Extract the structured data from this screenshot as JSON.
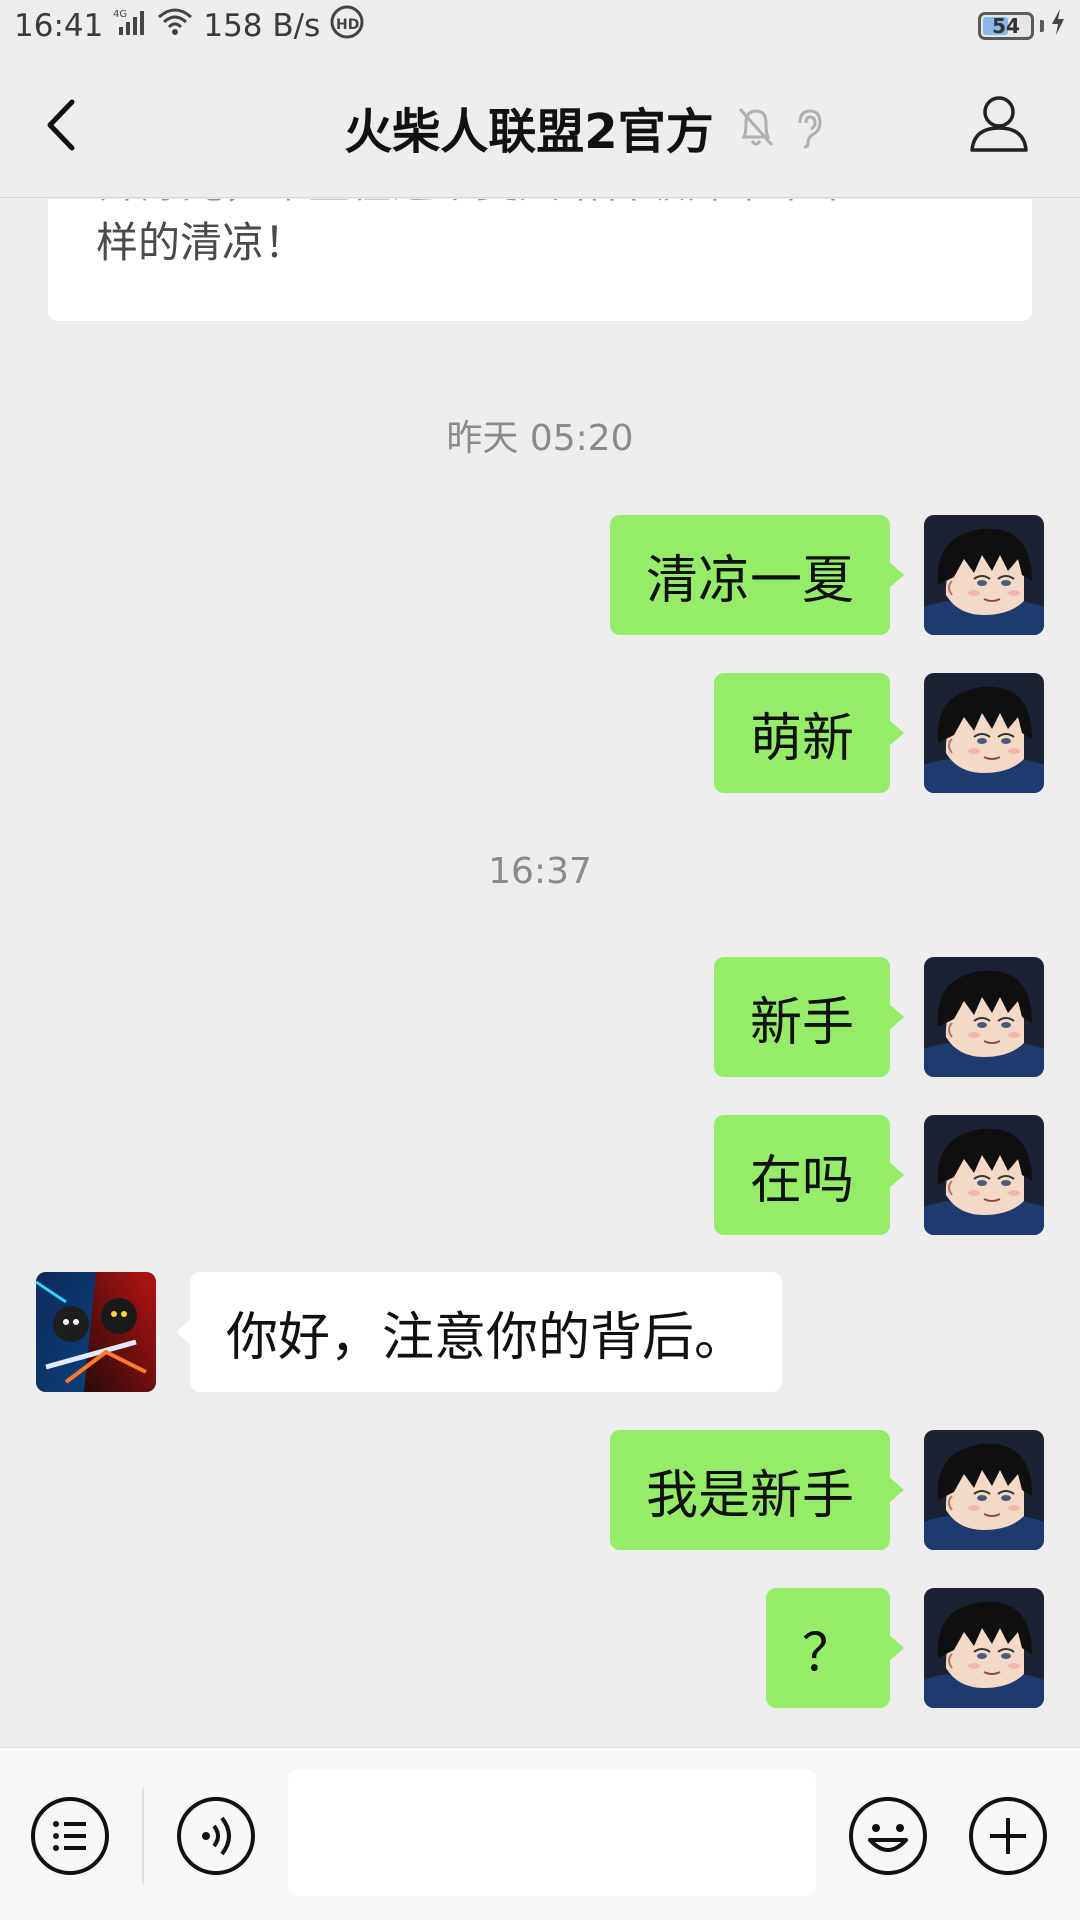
{
  "status_bar": {
    "time": "16:41",
    "network": "4G",
    "speed": "158 B/s",
    "hd": "HD",
    "battery": "54",
    "battery_level": 0.54
  },
  "header": {
    "back_icon": "chevron-left-icon",
    "title": "火柴人联盟2官方",
    "muted_icon": "bell-off-icon",
    "earpiece_icon": "ear-icon",
    "profile_icon": "person-icon"
  },
  "chat": {
    "article_card": {
      "line1": "开除光，希望在这个夏天给各级开带来不",
      "line2": "样的清凉！"
    },
    "timestamps": [
      "昨天 05:20",
      "16:37"
    ],
    "messages": [
      {
        "sender": "me",
        "text": "清凉一夏"
      },
      {
        "sender": "me",
        "text": "萌新"
      },
      {
        "sender": "me",
        "text": "新手"
      },
      {
        "sender": "me",
        "text": "在吗"
      },
      {
        "sender": "them",
        "text": "你好，注意你的背后。"
      },
      {
        "sender": "me",
        "text": "我是新手"
      },
      {
        "sender": "me",
        "text": "？"
      }
    ]
  },
  "input_bar": {
    "menu_icon": "list-icon",
    "voice_icon": "voice-icon",
    "input_placeholder": "",
    "emoji_icon": "emoji-icon",
    "add_icon": "plus-icon"
  },
  "colors": {
    "my_bubble": "#95ec69",
    "their_bubble": "#ffffff",
    "background": "#ededed"
  }
}
